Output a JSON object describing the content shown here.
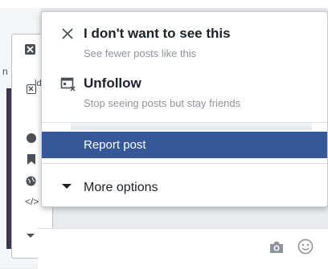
{
  "background": {
    "underlying_menu_fragment": "n",
    "underlying_menu_icon_letter": "ld",
    "code_icon_text": "</>"
  },
  "menu": {
    "items": [
      {
        "title": "I don't want to see this",
        "subtitle": "See fewer posts like this",
        "icon": "close-icon"
      },
      {
        "title": "Unfollow",
        "subtitle": "Stop seeing posts but stay friends",
        "icon": "unfollow-icon"
      }
    ],
    "report": {
      "label": "Report post",
      "highlighted": true,
      "highlight_color": "#365899"
    },
    "more": {
      "label": "More options",
      "icon": "caret-down-icon"
    }
  },
  "comment_bar": {
    "icons": [
      "camera-icon",
      "smile-icon"
    ]
  },
  "colors": {
    "title_text": "#1d2129",
    "subtitle_text": "#90949c",
    "highlight": "#365899"
  }
}
